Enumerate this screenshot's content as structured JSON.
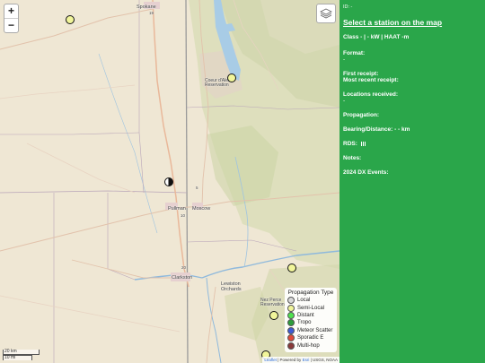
{
  "map": {
    "zoom_in": "+",
    "zoom_out": "−",
    "layers_icon": "layers-icon",
    "places": {
      "spokane": "Spokane",
      "hwy19": "19",
      "pullman": "Pullman",
      "moscow": "Moscow",
      "hwy5": "5",
      "hwy10": "10",
      "lewiston": "Lewiston",
      "lewiston_orchards": "Lewiston\nOrchards",
      "clarkston": "Clarkston",
      "coeur": "Coeur d'Alene\nReservation",
      "nez_perce": "Nez Perce\nReservation",
      "hwy20": "20"
    },
    "legend": {
      "title": "Propagation Type",
      "items": [
        {
          "label": "Local",
          "color": "#d9d9d9"
        },
        {
          "label": "Semi-Local",
          "color": "#f1f59a"
        },
        {
          "label": "Distant",
          "color": "#4fe14f"
        },
        {
          "label": "Tropo",
          "color": "#2c9d3c"
        },
        {
          "label": "Meteor Scatter",
          "color": "#3d5ad6"
        },
        {
          "label": "Sporadic E",
          "color": "#e04a3a"
        },
        {
          "label": "Multi-hop",
          "color": "#8a3a3a"
        }
      ]
    },
    "scale": {
      "km": "20 km",
      "mi": "10 mi"
    },
    "attribution": {
      "leaflet": "Leaflet",
      "sep": " | Powered by ",
      "esri": "Esri",
      "rest": " | USGS, NOAA"
    }
  },
  "panel": {
    "id_line": "ID: -",
    "select_link": "Select a station on the map",
    "class_line": "Class - | - kW | HAAT -m",
    "format_label": "Format:",
    "format_value": "-",
    "first_receipt_label": "First receipt:",
    "most_recent_label": "Most recent receipt:",
    "locations_label": "Locations received:",
    "locations_value": "-",
    "propagation_label": "Propagation:",
    "bearing_label": "Bearing/Distance: - - km",
    "rds_label": "RDS:",
    "notes_label": "Notes:",
    "dx_label": "2024 DX Events:"
  },
  "colors": {
    "panel_bg": "#2aa64a",
    "semi_local": "#f1f59a",
    "marker_dark": "#111111"
  }
}
